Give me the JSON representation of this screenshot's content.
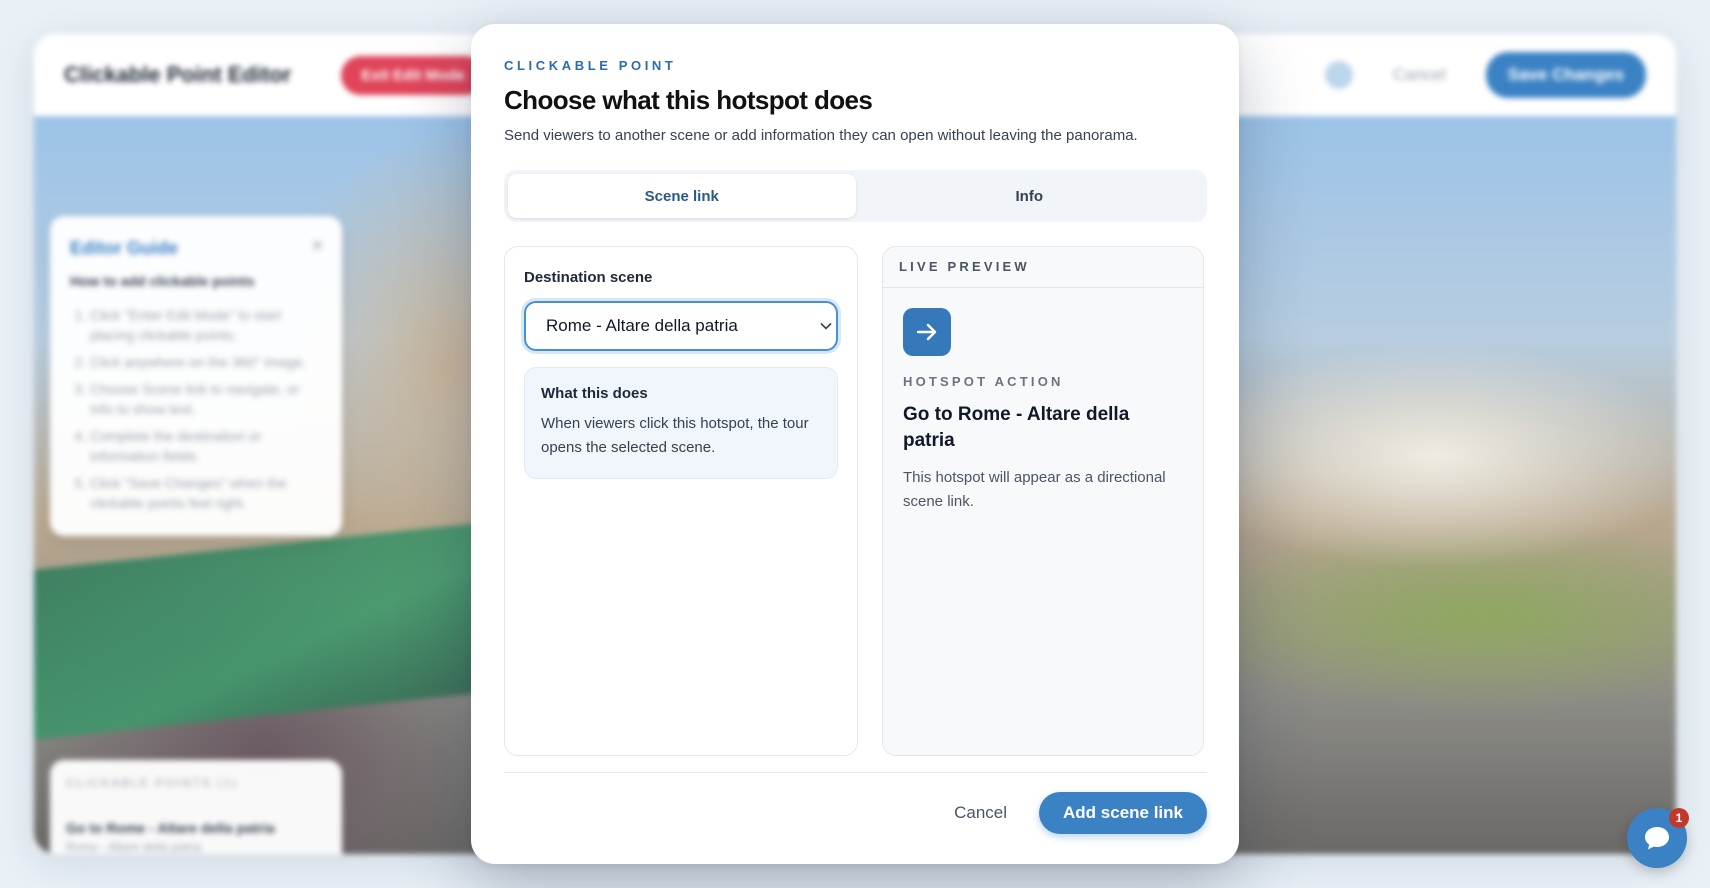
{
  "background_app": {
    "title": "Clickable Point Editor",
    "exit_edit_mode_label": "Exit Edit Mode",
    "cancel_label": "Cancel",
    "save_changes_label": "Save Changes",
    "guide": {
      "title": "Editor Guide",
      "subtitle": "How to add clickable points",
      "steps": [
        "Click \"Enter Edit Mode\" to start placing clickable points.",
        "Click anywhere on the 360° image.",
        "Choose Scene link to navigate, or Info to show text.",
        "Complete the destination or information fields.",
        "Click \"Save Changes\" when the clickable points feel right."
      ]
    },
    "points_panel": {
      "title": "CLICKABLE POINTS (1)",
      "item_title": "Go to Rome - Altare della patria",
      "item_subtitle": "Rome - Altare della patria"
    }
  },
  "modal": {
    "eyebrow": "CLICKABLE POINT",
    "title": "Choose what this hotspot does",
    "description": "Send viewers to another scene or add information they can open without leaving the panorama.",
    "tabs": [
      {
        "label": "Scene link",
        "active": true
      },
      {
        "label": "Info",
        "active": false
      }
    ],
    "destination_label": "Destination scene",
    "destination_value": "Rome - Altare della patria",
    "info_box": {
      "title": "What this does",
      "text": "When viewers click this hotspot, the tour opens the selected scene."
    },
    "preview": {
      "header": "LIVE PREVIEW",
      "icon": "arrow-right-icon",
      "eyebrow": "HOTSPOT ACTION",
      "title": "Go to Rome - Altare della patria",
      "text": "This hotspot will appear as a directional scene link."
    },
    "footer": {
      "cancel_label": "Cancel",
      "primary_label": "Add scene link"
    }
  },
  "chat": {
    "badge_count": "1",
    "icon": "chat-icon"
  },
  "colors": {
    "accent": "#3b82c4",
    "eyebrow": "#2b6cb0",
    "danger": "#e0445a",
    "badge": "#c0392b"
  }
}
